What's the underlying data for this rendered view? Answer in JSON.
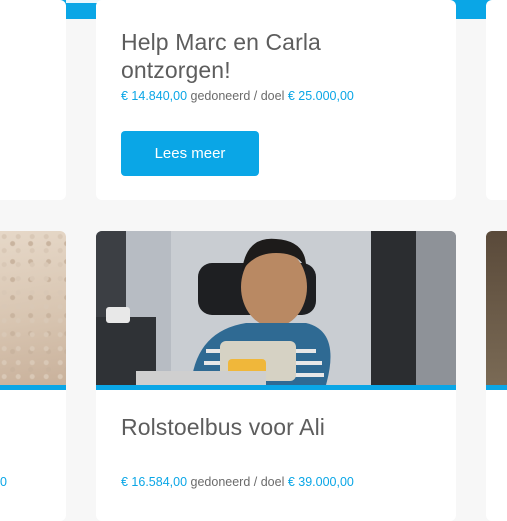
{
  "colors": {
    "accent": "#0aa6e6",
    "text": "#5d5d5d",
    "background": "#f7f7f7"
  },
  "top_card": {
    "title_line1": "Help Marc en Carla",
    "title_line2": "ontzorgen!",
    "raised": "€ 14.840,00",
    "raised_suffix": " gedoneerd / doel ",
    "goal": "€ 25.000,00",
    "button_label": "Lees meer"
  },
  "mid_card": {
    "title": "Rolstoelbus voor Ali",
    "raised": "€ 16.584,00",
    "raised_suffix": " gedoneerd / doel ",
    "goal": "€ 39.000,00"
  },
  "left_fragment": {
    "text": "0"
  },
  "icons": {
    "photo": "child-in-wheelchair-photo"
  }
}
